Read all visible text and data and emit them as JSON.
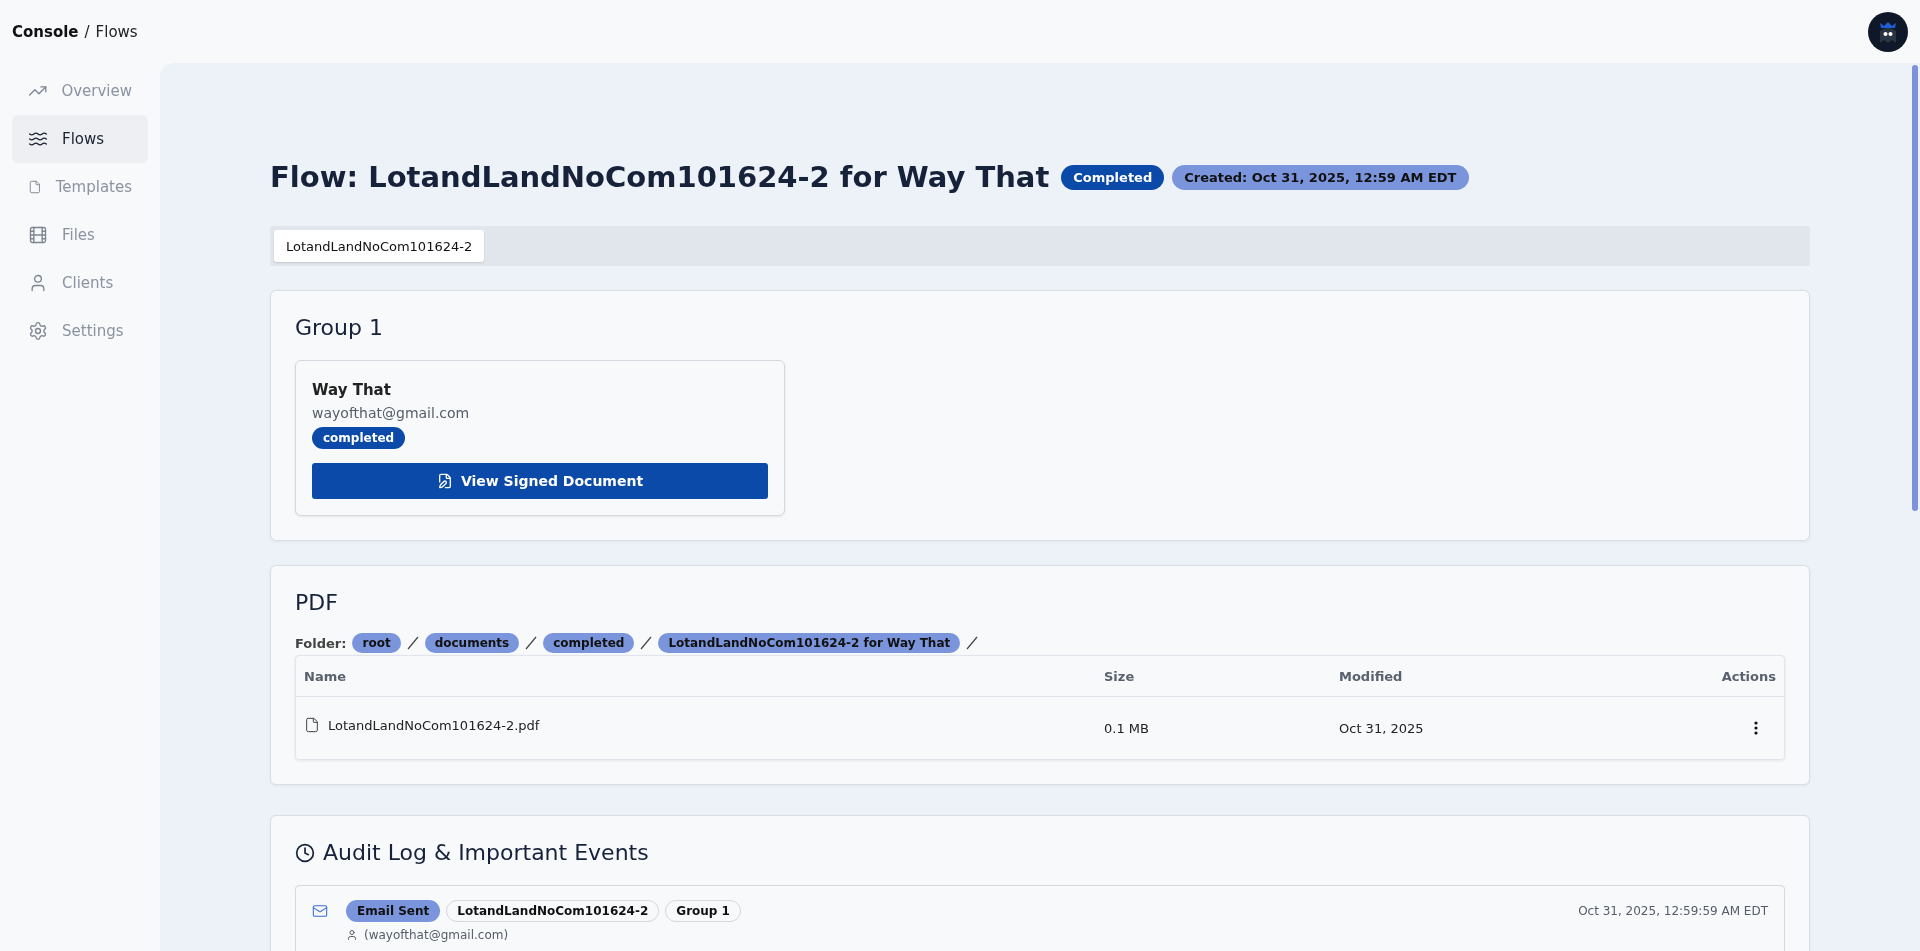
{
  "breadcrumb": {
    "root": "Console",
    "separator": "/",
    "current": "Flows"
  },
  "sidebar": {
    "items": [
      {
        "label": "Overview",
        "selected": false
      },
      {
        "label": "Flows",
        "selected": true
      },
      {
        "label": "Templates",
        "selected": false
      },
      {
        "label": "Files",
        "selected": false
      },
      {
        "label": "Clients",
        "selected": false
      },
      {
        "label": "Settings",
        "selected": false
      }
    ]
  },
  "header": {
    "title": "Flow: LotandLandNoCom101624-2 for Way That",
    "status": "Completed",
    "created": "Created: Oct 31, 2025, 12:59 AM EDT"
  },
  "tabs": [
    {
      "label": "LotandLandNoCom101624-2",
      "selected": true
    }
  ],
  "groups": [
    {
      "title": "Group 1",
      "signers": [
        {
          "name": "Way That",
          "email": "wayofthat@gmail.com",
          "status": "completed",
          "action": "View Signed Document"
        }
      ]
    }
  ],
  "pdf": {
    "title": "PDF",
    "folder_label": "Folder:",
    "folders": [
      "root",
      "documents",
      "completed",
      "LotandLandNoCom101624-2 for Way That"
    ],
    "table": {
      "columns": [
        "Name",
        "Size",
        "Modified",
        "Actions"
      ],
      "rows": [
        {
          "name": "LotandLandNoCom101624-2.pdf",
          "size": "0.1 MB",
          "modified": "Oct 31, 2025"
        }
      ]
    }
  },
  "audit": {
    "title": "Audit Log & Important Events",
    "events": [
      {
        "type": "Email Sent",
        "tags": [
          "LotandLandNoCom101624-2",
          "Group 1"
        ],
        "time": "Oct 31, 2025, 12:59:59 AM EDT",
        "detail": "(wayofthat@gmail.com)"
      }
    ]
  }
}
